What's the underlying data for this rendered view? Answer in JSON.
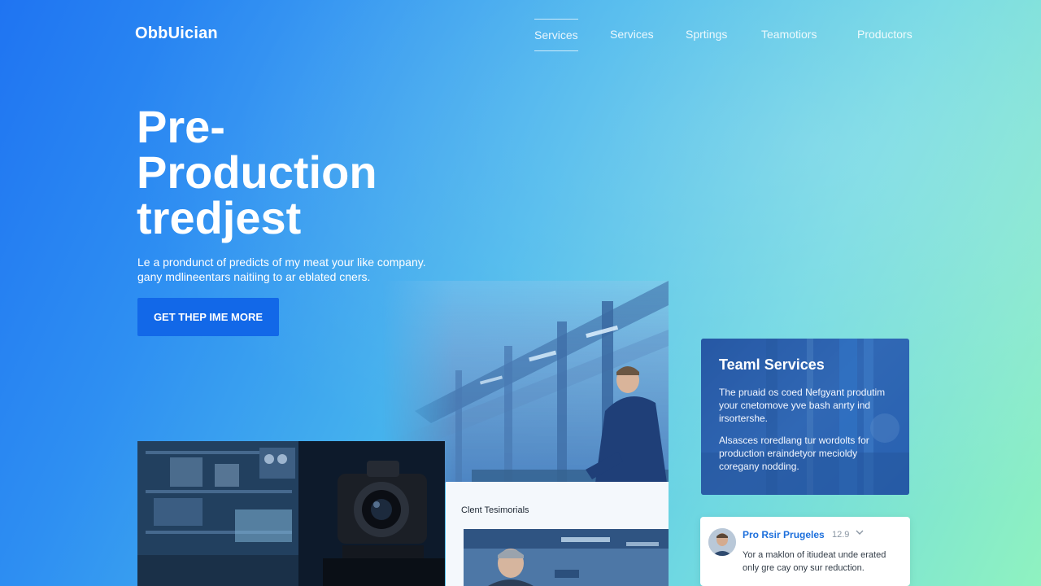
{
  "brand": {
    "logo": "ObbUician"
  },
  "nav": {
    "items": [
      {
        "label": "Services",
        "active": true
      },
      {
        "label": "Services",
        "active": false
      },
      {
        "label": "Sprtings",
        "active": false
      },
      {
        "label": "Teamotiors",
        "active": false
      },
      {
        "label": "Productors",
        "active": false
      }
    ]
  },
  "hero": {
    "title_lines": [
      "Pre-",
      "Production",
      "tredjest"
    ],
    "description_lines": [
      "Le a prondunct of predicts of my meat your like company.",
      "gany mdlineentars naitiing to ar eblated cners."
    ],
    "cta_label": "GET THEP IME MORE"
  },
  "testimonials": {
    "label": "Clent Tesimorials"
  },
  "services_card": {
    "title": "Teaml Services",
    "paragraph_1": "The pruaid os coed Nefgyant produtim your cnetomove yve bash anrty ind irsortershe.",
    "paragraph_2": "Alsasces roredlang tur wordolts for production eraindetyor mecioldy coregany nodding."
  },
  "review": {
    "name": "Pro Rsir Prugeles",
    "meta": "12.9",
    "text_lines": [
      "Yor a maklon of itiudeat unde erated",
      "only gre cay ony sur reduction."
    ]
  },
  "icons": {
    "review_chevron": "chevron-down-icon"
  },
  "colors": {
    "cta_background": "#1268e8",
    "review_name": "#1c6fdc",
    "gradient_start": "#1f74f2",
    "gradient_end": "#8ff2c0"
  }
}
